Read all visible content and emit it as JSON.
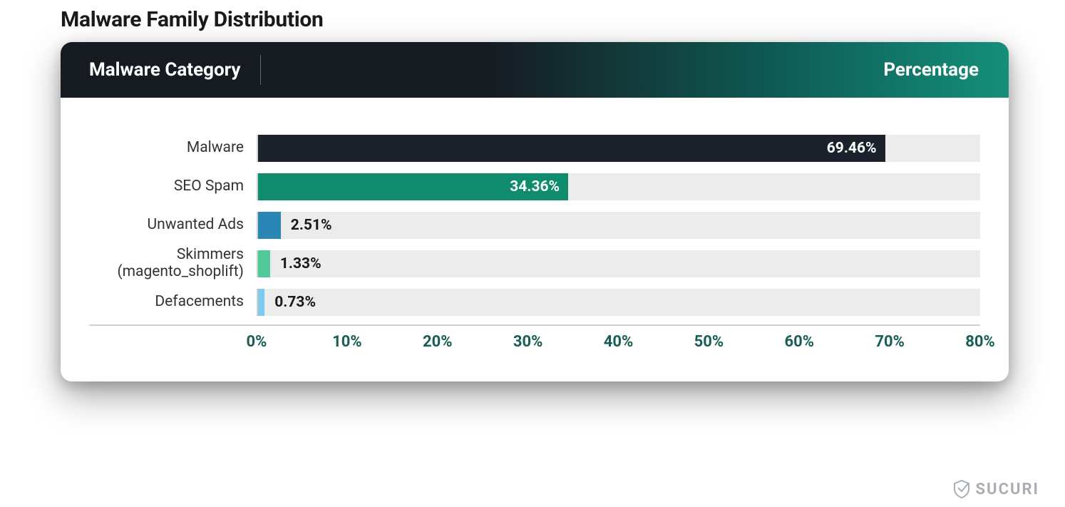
{
  "title": "Malware Family Distribution",
  "header": {
    "left": "Malware Category",
    "right": "Percentage"
  },
  "brand": "SUCURI",
  "axis": {
    "ticks": [
      "0%",
      "10%",
      "20%",
      "30%",
      "40%",
      "50%",
      "60%",
      "70%",
      "80%"
    ],
    "max": 80
  },
  "colors": {
    "bar0": "#1b222b",
    "bar1": "#0f8c6e",
    "bar2": "#2a86b4",
    "bar3": "#52c99a",
    "bar4": "#7ec9ef",
    "track": "#ececec",
    "tick": "#175e54"
  },
  "chart_data": {
    "type": "bar",
    "orientation": "horizontal",
    "title": "Malware Family Distribution",
    "xlabel": "Percentage",
    "ylabel": "Malware Category",
    "xlim": [
      0,
      80
    ],
    "categories": [
      "Malware",
      "SEO Spam",
      "Unwanted Ads",
      "Skimmers (magento_shoplift)",
      "Defacements"
    ],
    "values": [
      69.46,
      34.36,
      2.51,
      1.33,
      0.73
    ],
    "value_labels": [
      "69.46%",
      "34.36%",
      "2.51%",
      "1.33%",
      "0.73%"
    ],
    "category_lines": [
      [
        "Malware"
      ],
      [
        "SEO Spam"
      ],
      [
        "Unwanted Ads"
      ],
      [
        "Skimmers",
        "(magento_shoplift)"
      ],
      [
        "Defacements"
      ]
    ],
    "colors": [
      "#1b222b",
      "#0f8c6e",
      "#2a86b4",
      "#52c99a",
      "#7ec9ef"
    ]
  }
}
